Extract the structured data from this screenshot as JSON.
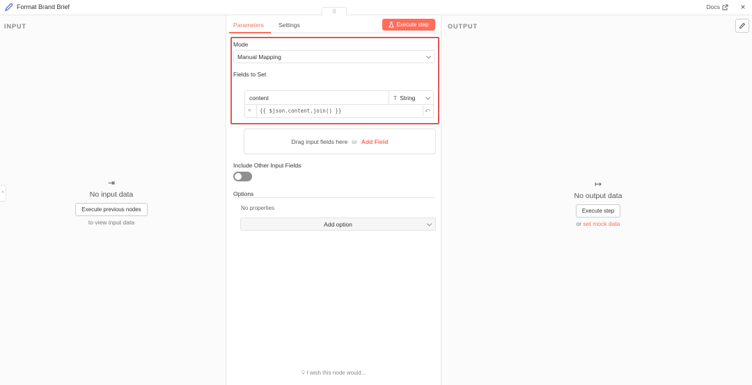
{
  "titlebar": {
    "title": "Format Brand Brief",
    "docs_label": "Docs",
    "title_icon": "pencil-icon",
    "close_icon": "close-icon"
  },
  "input_panel": {
    "header": "INPUT",
    "empty_title": "No input data",
    "button_label": "Execute previous nodes",
    "sub_text": "to view input data"
  },
  "output_panel": {
    "header": "OUTPUT",
    "empty_title": "No output data",
    "button_label": "Execute step",
    "sub_prefix": "or",
    "sub_link": "set mock data"
  },
  "center": {
    "tabs": [
      {
        "label": "Parameters",
        "active": true
      },
      {
        "label": "Settings",
        "active": false
      }
    ],
    "execute_label": "Execute step",
    "mode_label": "Mode",
    "mode_value": "Manual Mapping",
    "fields_label": "Fields to Set",
    "field": {
      "name": "content",
      "type": "String",
      "equals": "=",
      "expression": "{{ $json.content.join() }}"
    },
    "drop_text": "Drag input fields here",
    "drop_or": "or",
    "drop_link": "Add Field",
    "include_label": "Include Other Input Fields",
    "include_enabled": false,
    "options_label": "Options",
    "no_properties": "No properties",
    "add_option_label": "Add option",
    "feedback": "I wish this node would..."
  },
  "colors": {
    "accent": "#ff6d5a",
    "highlight_border": "#e05353"
  }
}
